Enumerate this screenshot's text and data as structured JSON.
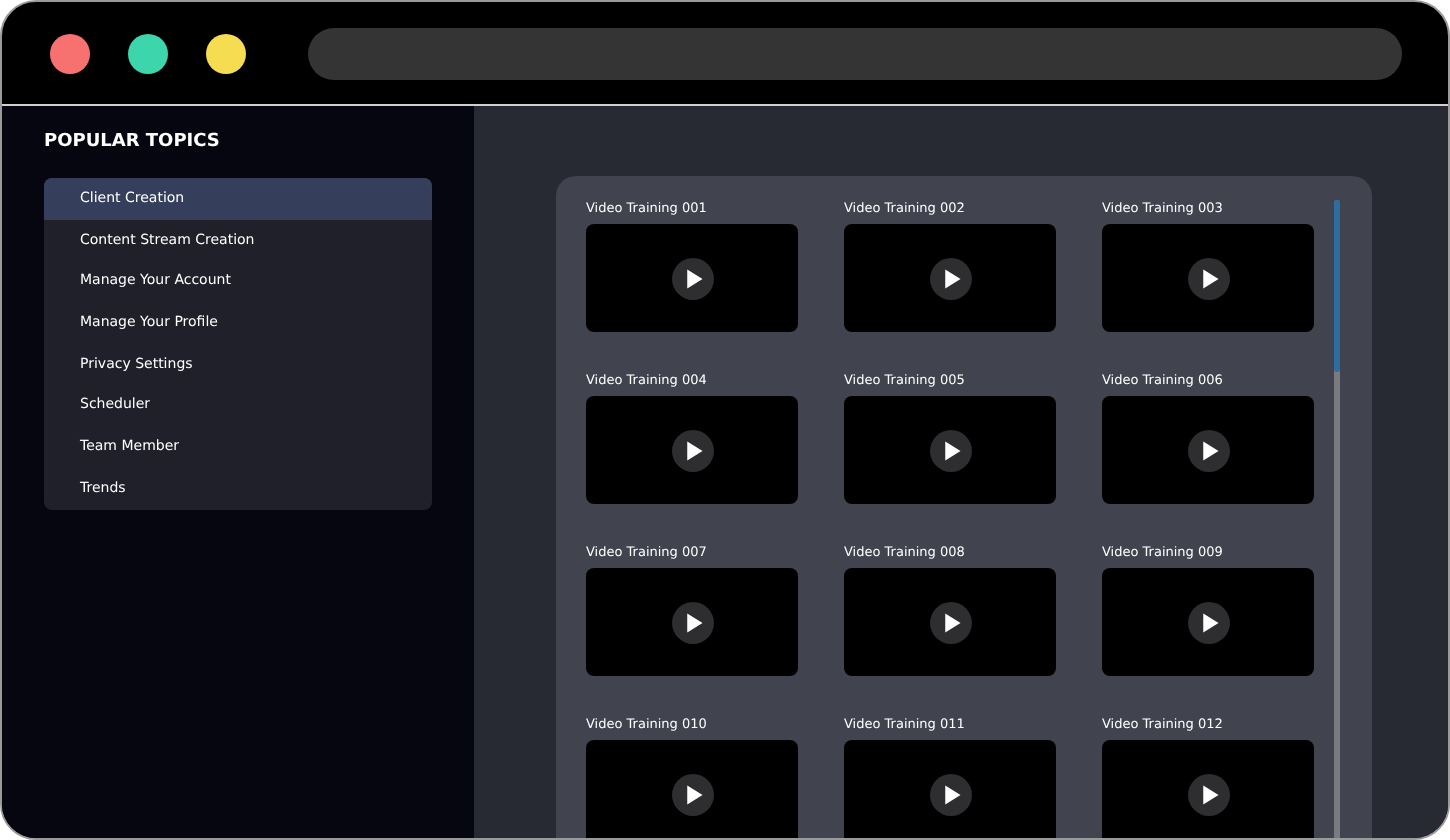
{
  "sidebar": {
    "title": "POPULAR TOPICS",
    "items": [
      {
        "label": "Client Creation",
        "selected": true
      },
      {
        "label": "Content Stream Creation",
        "selected": false
      },
      {
        "label": "Manage Your Account",
        "selected": false
      },
      {
        "label": "Manage Your Profile",
        "selected": false
      },
      {
        "label": "Privacy Settings",
        "selected": false
      },
      {
        "label": "Scheduler",
        "selected": false
      },
      {
        "label": "Team Member",
        "selected": false
      },
      {
        "label": "Trends",
        "selected": false
      }
    ]
  },
  "videos": [
    {
      "title": "Video Training 001"
    },
    {
      "title": "Video Training 002"
    },
    {
      "title": "Video Training 003"
    },
    {
      "title": "Video Training 004"
    },
    {
      "title": "Video Training 005"
    },
    {
      "title": "Video Training 006"
    },
    {
      "title": "Video Training 007"
    },
    {
      "title": "Video Training 008"
    },
    {
      "title": "Video Training 009"
    },
    {
      "title": "Video Training 010"
    },
    {
      "title": "Video Training 011"
    },
    {
      "title": "Video Training 012"
    }
  ]
}
